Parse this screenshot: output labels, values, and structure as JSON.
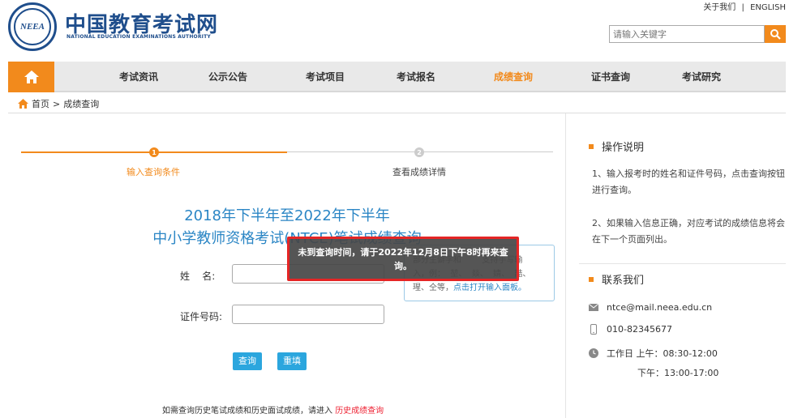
{
  "header": {
    "logo_text": "NEEA",
    "site_name": "中国教育考试网",
    "site_sub": "NATIONAL EDUCATION EXAMINATIONS AUTHORITY",
    "links": [
      "关于我们",
      "|",
      "ENGLISH"
    ],
    "search_placeholder": "请输入关键字"
  },
  "nav": {
    "items": [
      "考试资讯",
      "公示公告",
      "考试项目",
      "考试报名",
      "成绩查询",
      "证书查询",
      "考试研究"
    ],
    "active": "成绩查询"
  },
  "breadcrumb": {
    "home": "首页",
    "sep": ">",
    "current": "成绩查询"
  },
  "steps": [
    {
      "num": "1",
      "label": "输入查询条件"
    },
    {
      "num": "2",
      "label": "查看成绩详情"
    }
  ],
  "query": {
    "title_line1": "2018年下半年至2022年下半年",
    "title_line2": "中小学教师资格考试(NTCE)笔试成绩查询",
    "name_label": "姓    名:",
    "id_label": "证件号码:",
    "hint_line1": "部分生僻字和        支持手写输",
    "hint_line2": "入，例：  堃、  燚、  婧、  喆、",
    "hint_line3_prefix": "瑆、仝等，",
    "hint_link": "点击打开输入面板。",
    "search_btn": "查询",
    "reset_btn": "重填",
    "history_text": "如需查询历史笔试成绩和历史面试成绩，请进入",
    "history_link": "历史成绩查询"
  },
  "toast": "未到查询时间，请于2022年12月8日下午8时再来查询。",
  "sidebar": {
    "op_title": "操作说明",
    "op_1": "1、输入报考时的姓名和证件号码，点击查询按钮进行查询。",
    "op_2": "2、如果输入信息正确，对应考试的成绩信息将会在下一个页面列出。",
    "contact_title": "联系我们",
    "email": "ntce@mail.neea.edu.cn",
    "phone": "010-82345677",
    "hours_am": "工作日 上午：08:30-12:00",
    "hours_pm": "下午：13:00-17:00"
  },
  "colors": {
    "brand": "#1f4e8c",
    "accent": "#f28a1c",
    "link": "#2b86c5",
    "alert_border": "#e52525"
  }
}
